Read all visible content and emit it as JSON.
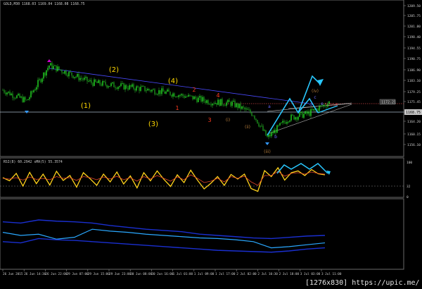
{
  "window": {
    "symbol_header": "GOLD,M30  1168.03 1169.04 1168.08 1168.75"
  },
  "price_pane": {
    "current_price": "1168.75",
    "marked_price": "1172.21",
    "alert_label": "5:5/LB"
  },
  "rsi_pane": {
    "header": "RSI(8) 60.2942  sMA(5) 55.3574",
    "levels": [
      "100",
      "32",
      "0"
    ]
  },
  "watermark": "[1276x830] https://upic.me/",
  "chart_data": [
    {
      "type": "line",
      "name": "price",
      "ylim": [
        1148,
        1214
      ],
      "yticks": [
        "1209.50",
        "1205.75",
        "1201.80",
        "1198.40",
        "1194.55",
        "1190.75",
        "1186.90",
        "1183.10",
        "1179.25",
        "1175.45",
        "1171.55",
        "1168.75",
        "1164.20",
        "1160.15",
        "1156.10",
        "1151.90"
      ],
      "x": [
        "26 Jun 2015",
        "26 Jun 14:30",
        "26 Jun 22:00",
        "29 Jun 07:00",
        "29 Jun 15:00",
        "29 Jun 23:00",
        "30 Jun 08:00",
        "30 Jun 16:00",
        "1 Jul 01:00",
        "1 Jul 09:00",
        "1 Jul 17:00",
        "2 Jul 02:00",
        "2 Jul 10:30",
        "2 Jul 18:00",
        "3 Jul 03:00",
        "3 Jul 11:00"
      ],
      "values": [
        1175.8,
        1170.8,
        1187.0,
        1182.2,
        1179.2,
        1177.1,
        1174.8,
        1172.5,
        1172.1,
        1170.2,
        1168.9,
        1164.3,
        1154.2,
        1163.1,
        1165.4,
        1170.6
      ],
      "wave_labels": [
        {
          "text": "(1)",
          "color": "#ffd700"
        },
        {
          "text": "(2)",
          "color": "#ffd700"
        },
        {
          "text": "(3)",
          "color": "#ffd700"
        },
        {
          "text": "(4)",
          "color": "#ffd700"
        },
        {
          "text": "1",
          "color": "#ff3b1f"
        },
        {
          "text": "2",
          "color": "#ff3b1f"
        },
        {
          "text": "3",
          "color": "#ff3b1f"
        },
        {
          "text": "4",
          "color": "#ff3b1f"
        },
        {
          "text": "(i)",
          "color": "#b07a3a"
        },
        {
          "text": "(ii)",
          "color": "#b07a3a"
        },
        {
          "text": "(iii)",
          "color": "#b07a3a"
        },
        {
          "text": "(iv)",
          "color": "#b07a3a"
        },
        {
          "text": "a",
          "color": "#6b6bff"
        },
        {
          "text": "b",
          "color": "#6b6bff"
        },
        {
          "text": "c",
          "color": "#6b6bff"
        },
        {
          "text": "d",
          "color": "#6b6bff"
        },
        {
          "text": "e",
          "color": "#6b6bff"
        }
      ]
    },
    {
      "type": "line",
      "name": "RSI(8)",
      "ylim": [
        0,
        100
      ],
      "series": [
        {
          "name": "RSI(8)",
          "values": [
            52,
            43,
            64,
            28,
            67,
            35,
            62,
            31,
            70,
            44,
            58,
            25,
            66,
            49,
            30,
            62,
            40,
            68,
            34,
            57,
            23,
            66,
            43,
            71,
            47,
            27,
            60,
            38,
            73,
            45,
            20,
            36,
            55,
            30,
            61,
            48,
            62,
            21,
            13,
            72,
            55,
            80,
            45,
            66,
            71,
            58,
            75,
            63,
            60
          ]
        },
        {
          "name": "sMA(5)",
          "values": [
            50,
            48,
            52,
            45,
            54,
            47,
            50,
            46,
            55,
            50,
            52,
            44,
            55,
            52,
            46,
            54,
            48,
            56,
            46,
            52,
            42,
            55,
            48,
            58,
            50,
            42,
            54,
            46,
            60,
            50,
            38,
            42,
            50,
            40,
            55,
            50,
            56,
            40,
            30,
            58,
            58,
            70,
            56,
            64,
            66,
            62,
            68,
            64,
            62
          ]
        }
      ]
    },
    {
      "type": "line",
      "name": "lower-indicator",
      "ylim": [
        0,
        100
      ],
      "series": [
        {
          "name": "line",
          "values": [
            55,
            50,
            52,
            44,
            47,
            60,
            57,
            55,
            52,
            50,
            48,
            46,
            45,
            43,
            40,
            30,
            32,
            35,
            38
          ]
        },
        {
          "name": "upper-band",
          "values": [
            72,
            70,
            75,
            73,
            72,
            70,
            66,
            63,
            60,
            58,
            56,
            52,
            50,
            48,
            46,
            45,
            47,
            49,
            50
          ]
        },
        {
          "name": "lower-band",
          "values": [
            40,
            38,
            45,
            43,
            42,
            40,
            38,
            36,
            34,
            32,
            30,
            28,
            26,
            25,
            24,
            23,
            25,
            28,
            30
          ]
        }
      ]
    }
  ]
}
